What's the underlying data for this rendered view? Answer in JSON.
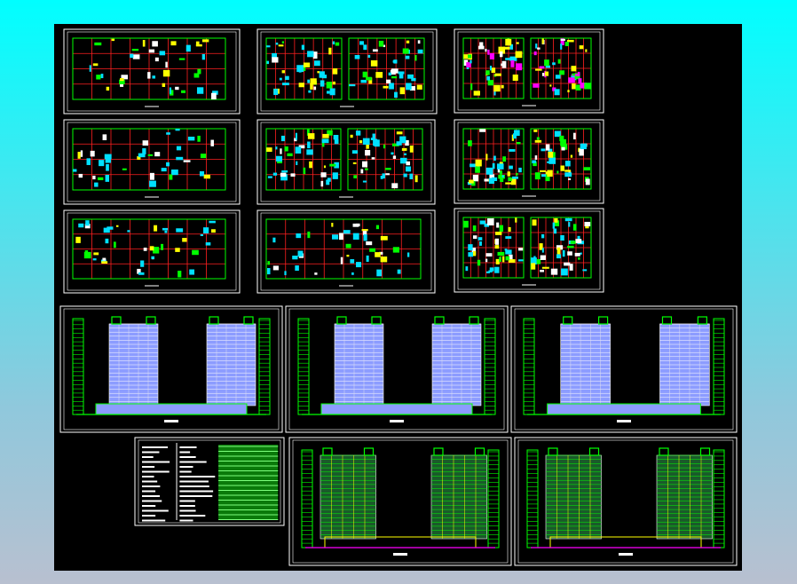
{
  "colors": {
    "background_top": "#00ffff",
    "background_bottom": "#b8c0d0",
    "canvas": "#000000",
    "frame": "#ffffff",
    "grid": "#ff2020",
    "lines": "#00ff00",
    "fill": "#00e0ff",
    "tower": "#8c9cff",
    "accent": "#ff00ff"
  },
  "sheets": [
    {
      "kind": "floor-plan"
    },
    {
      "kind": "floor-plan"
    },
    {
      "kind": "unit-plan"
    },
    {
      "kind": "floor-plan"
    },
    {
      "kind": "detail-plan"
    },
    {
      "kind": "unit-plan"
    },
    {
      "kind": "floor-plan"
    },
    {
      "kind": "floor-plan"
    },
    {
      "kind": "unit-plan"
    },
    {
      "kind": "elevation"
    },
    {
      "kind": "elevation"
    },
    {
      "kind": "elevation"
    },
    {
      "kind": "notes-table"
    },
    {
      "kind": "section"
    },
    {
      "kind": "section"
    }
  ]
}
